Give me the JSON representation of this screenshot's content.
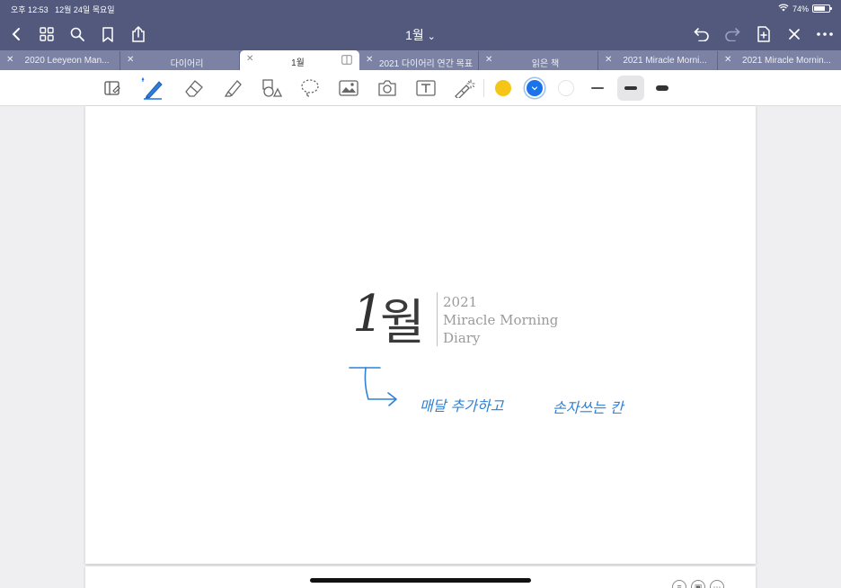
{
  "status": {
    "time": "오후 12:53",
    "date": "12월 24일 목요일",
    "battery": "74%",
    "battery_level": 0.74
  },
  "nav": {
    "title": "1월",
    "title_chevron": "⌄"
  },
  "tabs": [
    {
      "label": "2020 Leeyeon Man..."
    },
    {
      "label": "다이어리"
    },
    {
      "label": "1월",
      "active": true
    },
    {
      "label": "2021 다이어리 연간 목표"
    },
    {
      "label": "읽은 책"
    },
    {
      "label": "2021 Miracle Morni..."
    },
    {
      "label": "2021 Miracle Mornin..."
    }
  ],
  "toolbar": {
    "colors": [
      "#f5c518",
      "#1a73e8",
      "#ffffff"
    ],
    "selected_color": "#1a73e8",
    "line_widths": [
      "thin",
      "medium",
      "thick"
    ],
    "selected_width": "medium"
  },
  "page": {
    "month_num": "1",
    "month_kor": "월",
    "subtitle_year": "2021",
    "subtitle_title": "Miracle Morning",
    "subtitle_diary": "Diary",
    "annotation_1": "매달 추가하고",
    "annotation_2": "손자쓰는 칸"
  },
  "theme": {
    "bar": "#52597d",
    "tab_strip": "#7b82a4",
    "ink": "#2f80d6"
  }
}
